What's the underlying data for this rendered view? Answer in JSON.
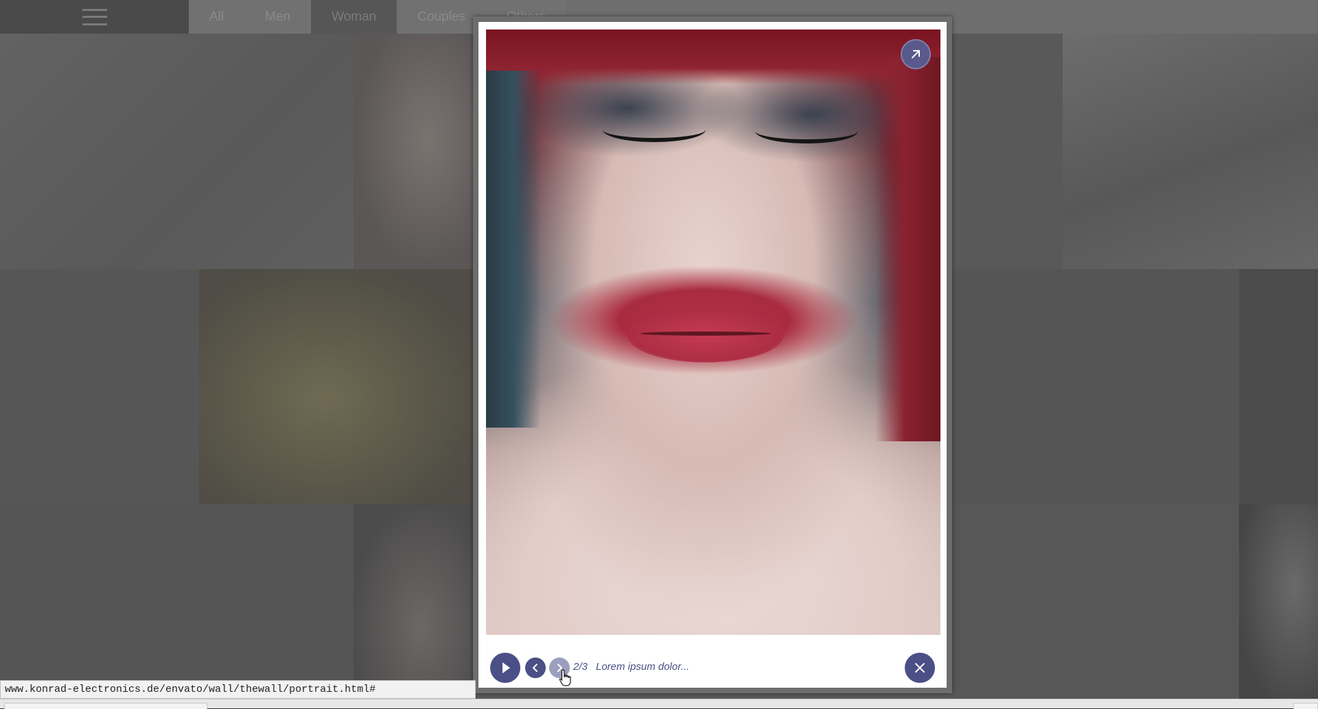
{
  "nav": {
    "filters": [
      {
        "label": "All",
        "active": false
      },
      {
        "label": "Men",
        "active": false
      },
      {
        "label": "Woman",
        "active": true
      },
      {
        "label": "Couples",
        "active": false
      },
      {
        "label": "Others",
        "active": false
      }
    ]
  },
  "lightbox": {
    "counter": "2/3",
    "caption": "Lorem ipsum dolor...",
    "image_subject": "portrait-woman-red-hair-closed-eyes"
  },
  "statusbar": {
    "url": "www.konrad-electronics.de/envato/wall/thewall/portrait.html#"
  },
  "colors": {
    "accent": "#4a4f86",
    "accent_disabled": "#9c9fbd",
    "overlay_bg": "#5a5a5a"
  },
  "icons": {
    "menu": "hamburger-icon",
    "expand": "arrow-up-right-icon",
    "play": "play-icon",
    "prev": "chevron-left-icon",
    "next": "chevron-right-icon",
    "close": "close-icon"
  }
}
